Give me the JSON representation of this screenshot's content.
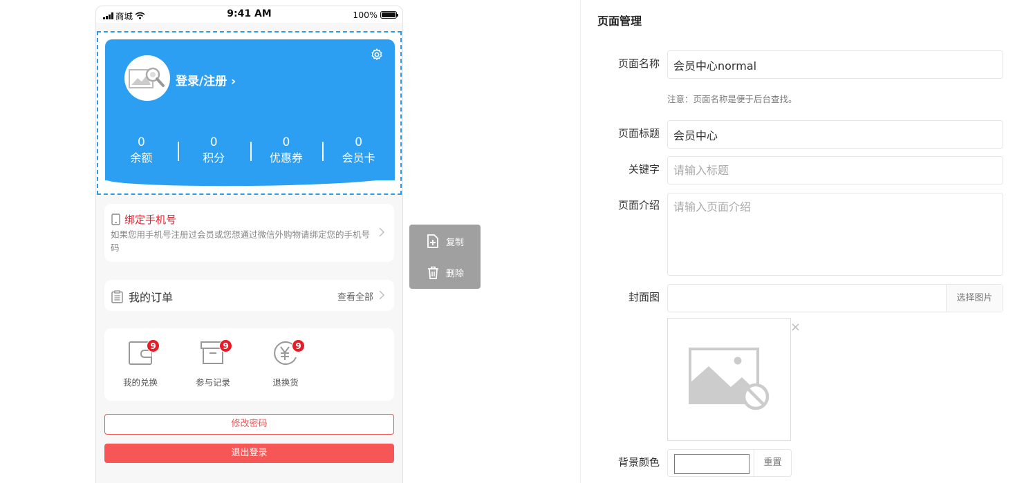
{
  "status_bar": {
    "carrier": "商城",
    "time": "9:41 AM",
    "battery": "100%"
  },
  "member_card": {
    "login_label": "登录/注册 ›",
    "stats": [
      {
        "value": "0",
        "label": "余额"
      },
      {
        "value": "0",
        "label": "积分"
      },
      {
        "value": "0",
        "label": "优惠券"
      },
      {
        "value": "0",
        "label": "会员卡"
      }
    ],
    "background_color": "#2d9ff2"
  },
  "bind_phone": {
    "title": "绑定手机号",
    "description": "如果您用手机号注册过会员或您想通过微信外购物请绑定您的手机号码"
  },
  "orders": {
    "title": "我的订单",
    "view_all": "查看全部"
  },
  "shortcuts": [
    {
      "label": "我的兑换",
      "badge": "9",
      "icon": "wallet-icon"
    },
    {
      "label": "参与记录",
      "badge": "9",
      "icon": "box-icon"
    },
    {
      "label": "退换货",
      "badge": "9",
      "icon": "yen-refund-icon"
    }
  ],
  "buttons": {
    "change_password": "修改密码",
    "logout": "退出登录"
  },
  "action_menu": {
    "copy": "复制",
    "delete": "删除"
  },
  "panel": {
    "title": "页面管理",
    "page_name": {
      "label": "页面名称",
      "value": "会员中心normal",
      "hint": "注意：页面名称是便于后台查找。"
    },
    "page_title": {
      "label": "页面标题",
      "value": "会员中心"
    },
    "keywords": {
      "label": "关键字",
      "placeholder": "请输入标题"
    },
    "description": {
      "label": "页面介绍",
      "placeholder": "请输入页面介绍"
    },
    "cover": {
      "label": "封面图",
      "select_label": "选择图片",
      "close": "×"
    },
    "bg_color": {
      "label": "背景颜色",
      "reset_label": "重置",
      "value": "#ffffff"
    }
  }
}
